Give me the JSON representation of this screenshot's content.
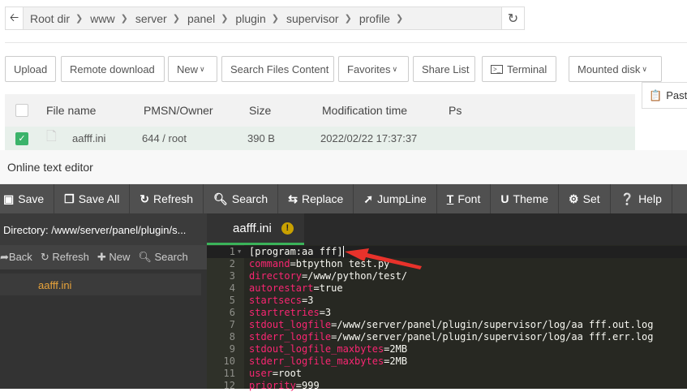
{
  "breadcrumb": {
    "items": [
      "Root dir",
      "www",
      "server",
      "panel",
      "plugin",
      "supervisor",
      "profile"
    ]
  },
  "toolbar": {
    "upload": "Upload",
    "remote_download": "Remote download",
    "new": "New",
    "search_content": "Search Files Content",
    "favorites": "Favorites",
    "share_list": "Share List",
    "terminal": "Terminal",
    "mounted_disk": "Mounted disk",
    "paste": "Paste"
  },
  "table": {
    "headers": [
      "File name",
      "PMSN/Owner",
      "Size",
      "Modification time",
      "Ps"
    ],
    "rows": [
      {
        "name": "aafff.ini",
        "perm": "644 / root",
        "size": "390 B",
        "mtime": "2022/02/22 17:37:37",
        "checked": true
      }
    ]
  },
  "editor": {
    "title": "Online text editor",
    "toolbar": [
      "Save",
      "Save All",
      "Refresh",
      "Search",
      "Replace",
      "JumpLine",
      "Font",
      "Theme",
      "Set",
      "Help"
    ],
    "directory": "Directory: /www/server/panel/plugin/s...",
    "side_tools": [
      "Back",
      "Refresh",
      "New",
      "Search"
    ],
    "files": [
      "aafff.ini"
    ],
    "tab": "aafff.ini",
    "lines": [
      {
        "n": "1",
        "key": "",
        "val": "[program:aa fff]"
      },
      {
        "n": "2",
        "key": "command",
        "val": "=btpython test.py"
      },
      {
        "n": "3",
        "key": "directory",
        "val": "=/www/python/test/"
      },
      {
        "n": "4",
        "key": "autorestart",
        "val": "=true"
      },
      {
        "n": "5",
        "key": "startsecs",
        "val": "=3"
      },
      {
        "n": "6",
        "key": "startretries",
        "val": "=3"
      },
      {
        "n": "7",
        "key": "stdout_logfile",
        "val": "=/www/server/panel/plugin/supervisor/log/aa fff.out.log"
      },
      {
        "n": "8",
        "key": "stderr_logfile",
        "val": "=/www/server/panel/plugin/supervisor/log/aa fff.err.log"
      },
      {
        "n": "9",
        "key": "stdout_logfile_maxbytes",
        "val": "=2MB"
      },
      {
        "n": "10",
        "key": "stderr_logfile_maxbytes",
        "val": "=2MB"
      },
      {
        "n": "11",
        "key": "user",
        "val": "=root"
      },
      {
        "n": "12",
        "key": "priority",
        "val": "=999"
      }
    ]
  },
  "colors": {
    "accent": "#3bb35a",
    "keyword": "#f92672",
    "annotation_arrow": "#e8322b"
  }
}
